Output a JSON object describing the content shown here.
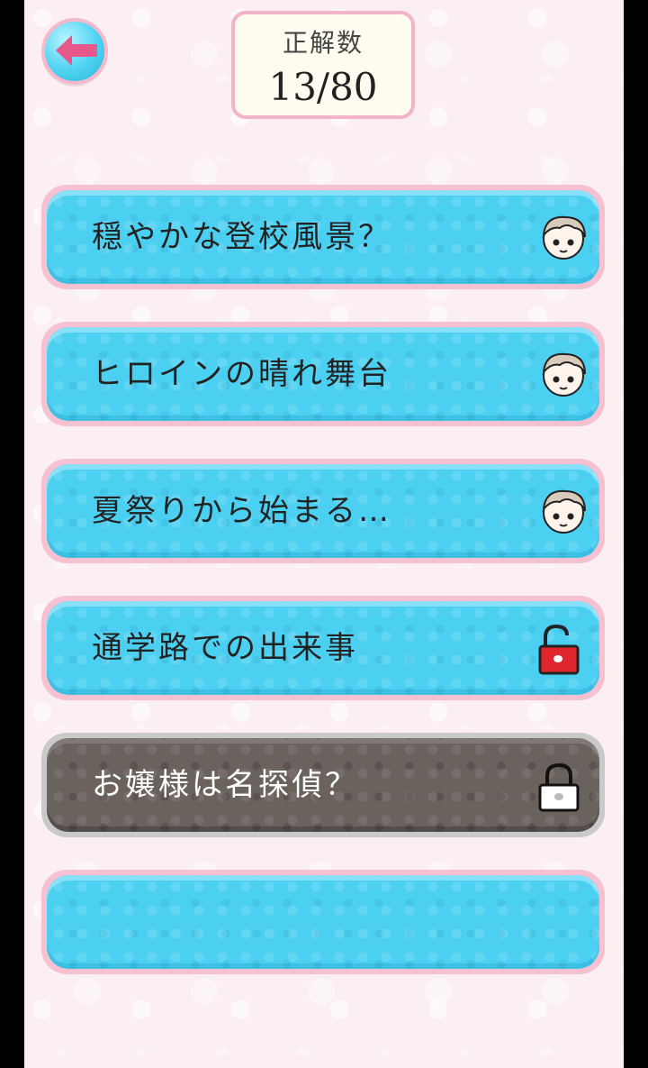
{
  "header": {
    "back_icon": "back-arrow-icon",
    "score_label": "正解数",
    "score_value": "13/80"
  },
  "colors": {
    "accent_pink": "#e8578a",
    "item_blue": "#4cd0f2",
    "item_locked": "#6a625d",
    "border_pink": "#f7c1d1"
  },
  "stages": [
    {
      "title": "穏やかな登校風景？",
      "icon": "character-face-icon",
      "status": "cleared"
    },
    {
      "title": "ヒロインの晴れ舞台",
      "icon": "character-face-icon",
      "status": "cleared"
    },
    {
      "title": "夏祭りから始まる…",
      "icon": "character-face-icon",
      "status": "cleared"
    },
    {
      "title": "通学路での出来事",
      "icon": "unlocked-padlock-icon",
      "status": "unlocked"
    },
    {
      "title": "お嬢様は名探偵？",
      "icon": "locked-padlock-icon",
      "status": "locked"
    },
    {
      "title": "",
      "icon": "",
      "status": "empty"
    }
  ]
}
